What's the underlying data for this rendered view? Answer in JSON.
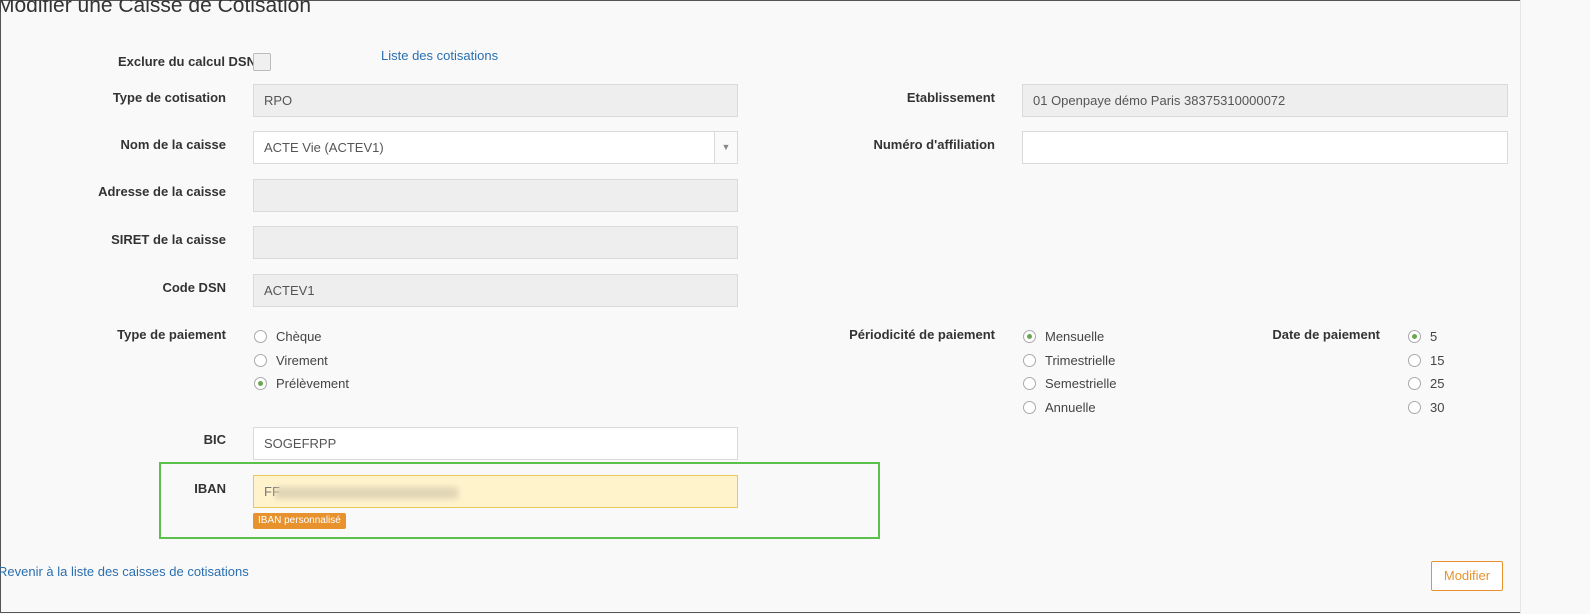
{
  "page": {
    "title": "Modifier une Caisse de Cotisation"
  },
  "form": {
    "exclure_dsn": {
      "label": "Exclure du calcul DSN",
      "checked": false
    },
    "liste_link": "Liste des cotisations",
    "type_cotisation": {
      "label": "Type de cotisation",
      "value": "RPO"
    },
    "etablissement": {
      "label": "Etablissement",
      "value": "01 Openpaye démo Paris 38375310000072"
    },
    "nom_caisse": {
      "label": "Nom de la caisse",
      "value": "ACTE Vie (ACTEV1)"
    },
    "numero_affiliation": {
      "label": "Numéro d'affiliation",
      "value": ""
    },
    "adresse_caisse": {
      "label": "Adresse de la caisse",
      "value": ""
    },
    "siret_caisse": {
      "label": "SIRET de la caisse",
      "value": ""
    },
    "code_dsn": {
      "label": "Code DSN",
      "value": "ACTEV1"
    },
    "type_paiement": {
      "label": "Type de paiement",
      "options": [
        "Chèque",
        "Virement",
        "Prélèvement"
      ],
      "selected": "Prélèvement"
    },
    "periodicite": {
      "label": "Périodicité de paiement",
      "options": [
        "Mensuelle",
        "Trimestrielle",
        "Semestrielle",
        "Annuelle"
      ],
      "selected": "Mensuelle"
    },
    "date_paiement": {
      "label": "Date de paiement",
      "options": [
        "5",
        "15",
        "25",
        "30"
      ],
      "selected": "5"
    },
    "bic": {
      "label": "BIC",
      "value": "SOGEFRPP"
    },
    "iban": {
      "label": "IBAN",
      "value": "FF",
      "badge": "IBAN personnalisé"
    }
  },
  "footer": {
    "back_link": "Revenir à la liste des caisses de cotisations",
    "submit_label": "Modifier"
  },
  "colors": {
    "accent_orange": "#e8922e",
    "link_blue": "#2a6fb0",
    "highlight_green": "#5cc04c",
    "radio_green": "#6aa84f"
  }
}
